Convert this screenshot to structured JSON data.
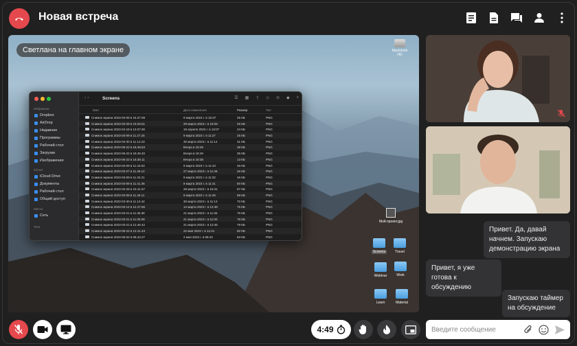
{
  "header": {
    "title": "Новая встреча"
  },
  "screen_share": {
    "presenter_label": "Светлана на главном экране",
    "desktop_disk_label": "Macintosh HD",
    "finder": {
      "title": "Screens",
      "sidebar": {
        "sections": [
          {
            "label": "Избранное",
            "items": [
              "Dropbox",
              "AirDrop",
              "Недавние",
              "Программы",
              "Рабочий стол",
              "Загрузки",
              "Изображения"
            ]
          },
          {
            "label": "iCloud",
            "items": [
              "iCloud Drive",
              "Документы",
              "Рабочий стол",
              "Общий доступ"
            ]
          },
          {
            "label": "Места",
            "items": [
              "Сеть"
            ]
          },
          {
            "label": "Теги",
            "items": []
          }
        ]
      },
      "columns": {
        "name": "Имя",
        "date": "Дата изменения",
        "size": "Размер",
        "kind": "Тип"
      },
      "files": [
        {
          "name": "Снимок экрана 2023-03-09 в 16.37.09",
          "date": "9 марта 2023 г. в 16:37",
          "size": "25 КБ",
          "kind": "PNG"
        },
        {
          "name": "Снимок экрана 2023-03-29 в 19.29.51",
          "date": "29 марта 2023 г. в 19:29",
          "size": "25 КБ",
          "kind": "PNG"
        },
        {
          "name": "Снимок экрана 2023-04-18 в 13.07.00",
          "date": "18 апреля 2023 г. в 13:07",
          "size": "24 КБ",
          "kind": "PNG"
        },
        {
          "name": "Снимок экрана 2023-03-09 в 11.27.25",
          "date": "9 марта 2023 г. в 11:27",
          "size": "25 КБ",
          "kind": "PNG"
        },
        {
          "name": "Снимок экрана 2023-03-30 в 11.14.23",
          "date": "30 марта 2023 г. в 11:14",
          "size": "31 КБ",
          "kind": "PNG"
        },
        {
          "name": "Снимок экрана 2023-06-22 в 18.49.53",
          "date": "Вчера в 18:49",
          "size": "38 КБ",
          "kind": "PNG"
        },
        {
          "name": "Снимок экрана 2023-06-22 в 18.49.40",
          "date": "Вчера в 18:49",
          "size": "35 КБ",
          "kind": "PNG"
        },
        {
          "name": "Снимок экрана 2023-06-22 в 18.38.11",
          "date": "Вчера в 18:38",
          "size": "13 КБ",
          "kind": "PNG"
        },
        {
          "name": "Снимок экрана 2023-03-09 в 11.43.53",
          "date": "9 марта 2023 г. в 11:43",
          "size": "46 КБ",
          "kind": "PNG"
        },
        {
          "name": "Снимок экрана 2023-03-27 в 11.46.12",
          "date": "27 марта 2023 г. в 11:46",
          "size": "46 КБ",
          "kind": "PNG"
        },
        {
          "name": "Снимок экрана 2023-03-09 в 11.32.21",
          "date": "9 марта 2023 г. в 11:32",
          "size": "46 КБ",
          "kind": "PNG"
        },
        {
          "name": "Снимок экрана 2023-03-09 в 11.41.36",
          "date": "9 марта 2023 г. в 11:41",
          "size": "50 КБ",
          "kind": "PNG"
        },
        {
          "name": "Снимок экрана 2023-03-28 в 15.41.57",
          "date": "28 марта 2023 г. в 15:41",
          "size": "67 КБ",
          "kind": "PNG"
        },
        {
          "name": "Снимок экрана 2023-03-09 в 11.46.11",
          "date": "9 марта 2023 г. в 11:46",
          "size": "68 КБ",
          "kind": "PNG"
        },
        {
          "name": "Снимок экрана 2023-03-30 в 11.13.42",
          "date": "30 марта 2023 г. в 11:13",
          "size": "70 КБ",
          "kind": "PNG"
        },
        {
          "name": "Снимок экрана 2023-03-14 в 12.47.56",
          "date": "14 марта 2023 г. в 12:48",
          "size": "75 КБ",
          "kind": "PNG"
        },
        {
          "name": "Снимок экрана 2023-03-21 в 11.36.38",
          "date": "21 марта 2023 г. в 11:36",
          "size": "76 КБ",
          "kind": "PNG"
        },
        {
          "name": "Снимок экрана 2023-03-21 в 11.00.09",
          "date": "21 марта 2023 г. в 11:00",
          "size": "78 КБ",
          "kind": "PNG"
        },
        {
          "name": "Снимок экрана 2023-03-21 в 12.46.42",
          "date": "21 марта 2023 г. в 12:46",
          "size": "79 КБ",
          "kind": "PNG"
        },
        {
          "name": "Снимок экрана 2023-05-22 в 12.41.43",
          "date": "22 мая 2023 г. в 12:41",
          "size": "82 КБ",
          "kind": "PNG"
        },
        {
          "name": "Снимок экрана 2023-05-02 в 08.43.27",
          "date": "2 мая 2023 г. в 08:43",
          "size": "83 КБ",
          "kind": "PNG"
        }
      ]
    },
    "desktop_items": {
      "photo": "Мой проект.jpg",
      "folders": [
        "Screens",
        "Travel",
        "Webinar",
        "Work",
        "Learn",
        "Material"
      ]
    }
  },
  "chat": {
    "messages": [
      {
        "text": "Привет. Да, давай начнем. Запускаю демонстрацию экрана"
      },
      {
        "text": "Привет, я уже готова к обсуждению"
      },
      {
        "text": "Запускаю таймер на обсуждение"
      }
    ],
    "input_placeholder": "Введите сообщение"
  },
  "controls": {
    "timer": "4:49"
  },
  "colors": {
    "end_call": "#e5484d",
    "mic_off": "#e5484d",
    "background": "#202020",
    "chat_bubble": "#333335"
  }
}
